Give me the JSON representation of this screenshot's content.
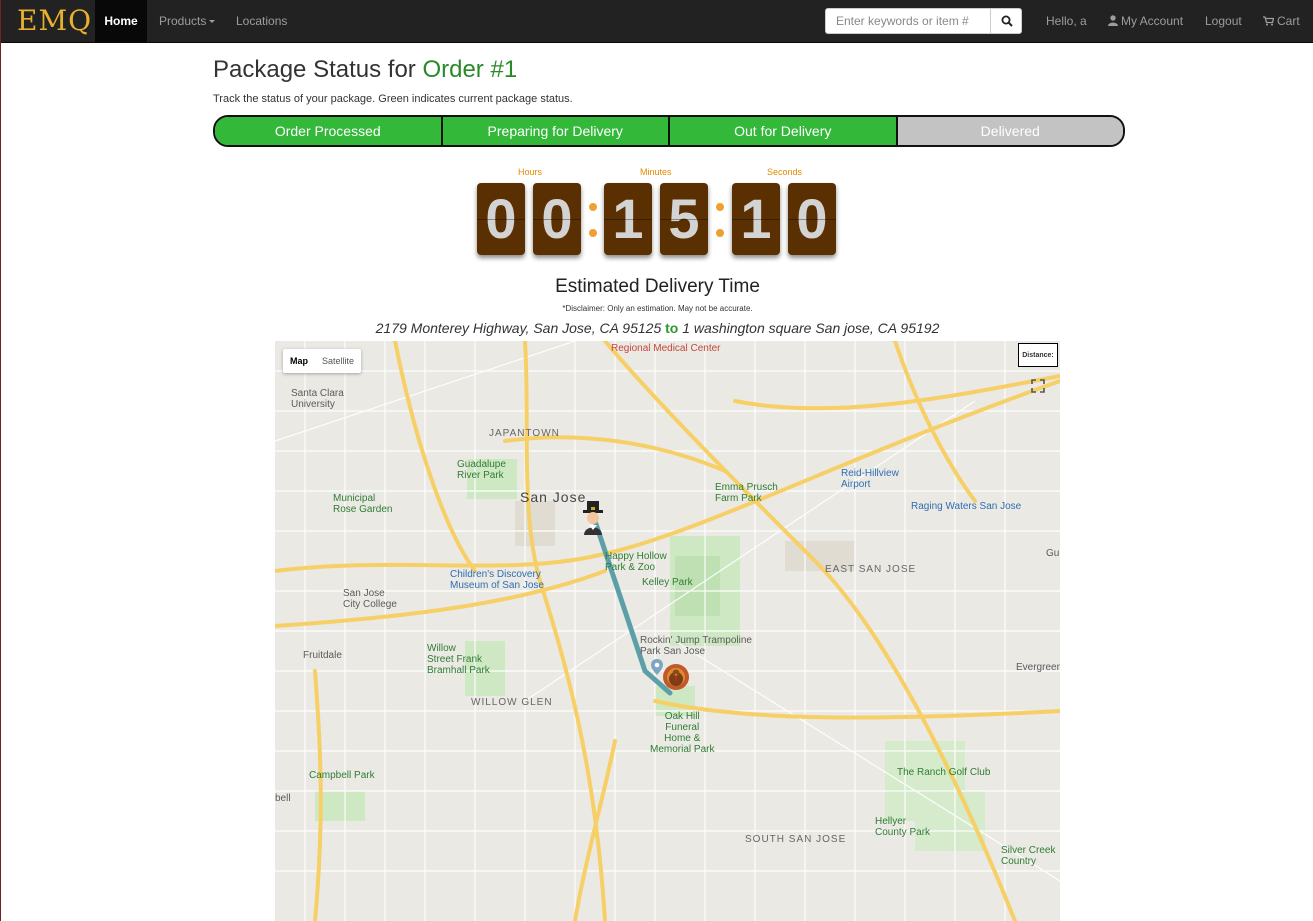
{
  "navbar": {
    "brand": "EMQ",
    "home": "Home",
    "products": "Products",
    "locations": "Locations",
    "search_placeholder": "Enter keywords or item #",
    "hello": "Hello, a",
    "account": "My Account",
    "logout": "Logout",
    "cart": "Cart"
  },
  "header": {
    "title_prefix": "Package Status for ",
    "order": "Order #1",
    "subtitle": "Track the status of your package. Green indicates current package status."
  },
  "steps": [
    {
      "label": "Order Processed",
      "status": "done"
    },
    {
      "label": "Preparing for Delivery",
      "status": "done"
    },
    {
      "label": "Out for Delivery",
      "status": "done"
    },
    {
      "label": "Delivered",
      "status": "pending"
    }
  ],
  "countdown": {
    "hours_label": "Hours",
    "minutes_label": "Minutes",
    "seconds_label": "Seconds",
    "digits": [
      "0",
      "0",
      "1",
      "5",
      "1",
      "0"
    ]
  },
  "eta": {
    "title": "Estimated Delivery Time",
    "disclaimer": "*Disclaimer: Only an estimation. May not be accurate.",
    "from": "2179 Monterey Highway, San Jose, CA 95125",
    "to_word": "to",
    "to": "1 washington square San jose, CA 95192"
  },
  "map": {
    "map_tab": "Map",
    "satellite_tab": "Satellite",
    "distance_label": "Distance:",
    "labels": {
      "regional": "Regional Medical Center",
      "santa_clara": "Santa Clara\nUniversity",
      "japantown": "JAPANTOWN",
      "guadalupe": "Guadalupe\nRiver Park",
      "san_jose": "San Jose",
      "emma": "Emma Prusch\nFarm Park",
      "reid": "Reid-Hillview\nAirport",
      "raging": "Raging Waters San Jose",
      "municipal": "Municipal\nRose Garden",
      "happy": "Happy Hollow\nPark & Zoo",
      "kelley": "Kelley Park",
      "childrens": "Children's Discovery\nMuseum of San Jose",
      "east_sj": "EAST SAN JOSE",
      "sj_city": "San Jose\nCity College",
      "fruitdale": "Fruitdale",
      "willow": "Willow\nStreet Frank\nBramhall Park",
      "rockin": "Rockin' Jump Trampoline\nPark San Jose",
      "evergreen": "Evergreen",
      "willow_glen": "WILLOW GLEN",
      "oak_hill": "Oak Hill\nFuneral\nHome &\nMemorial Park",
      "campbell": "Campbell Park",
      "ranch": "The Ranch Golf Club",
      "hellyer": "Hellyer\nCounty Park",
      "south_sj": "SOUTH SAN JOSE",
      "silver": "Silver Creek\nCountry",
      "bell": "bell",
      "gu": "Gu"
    }
  }
}
